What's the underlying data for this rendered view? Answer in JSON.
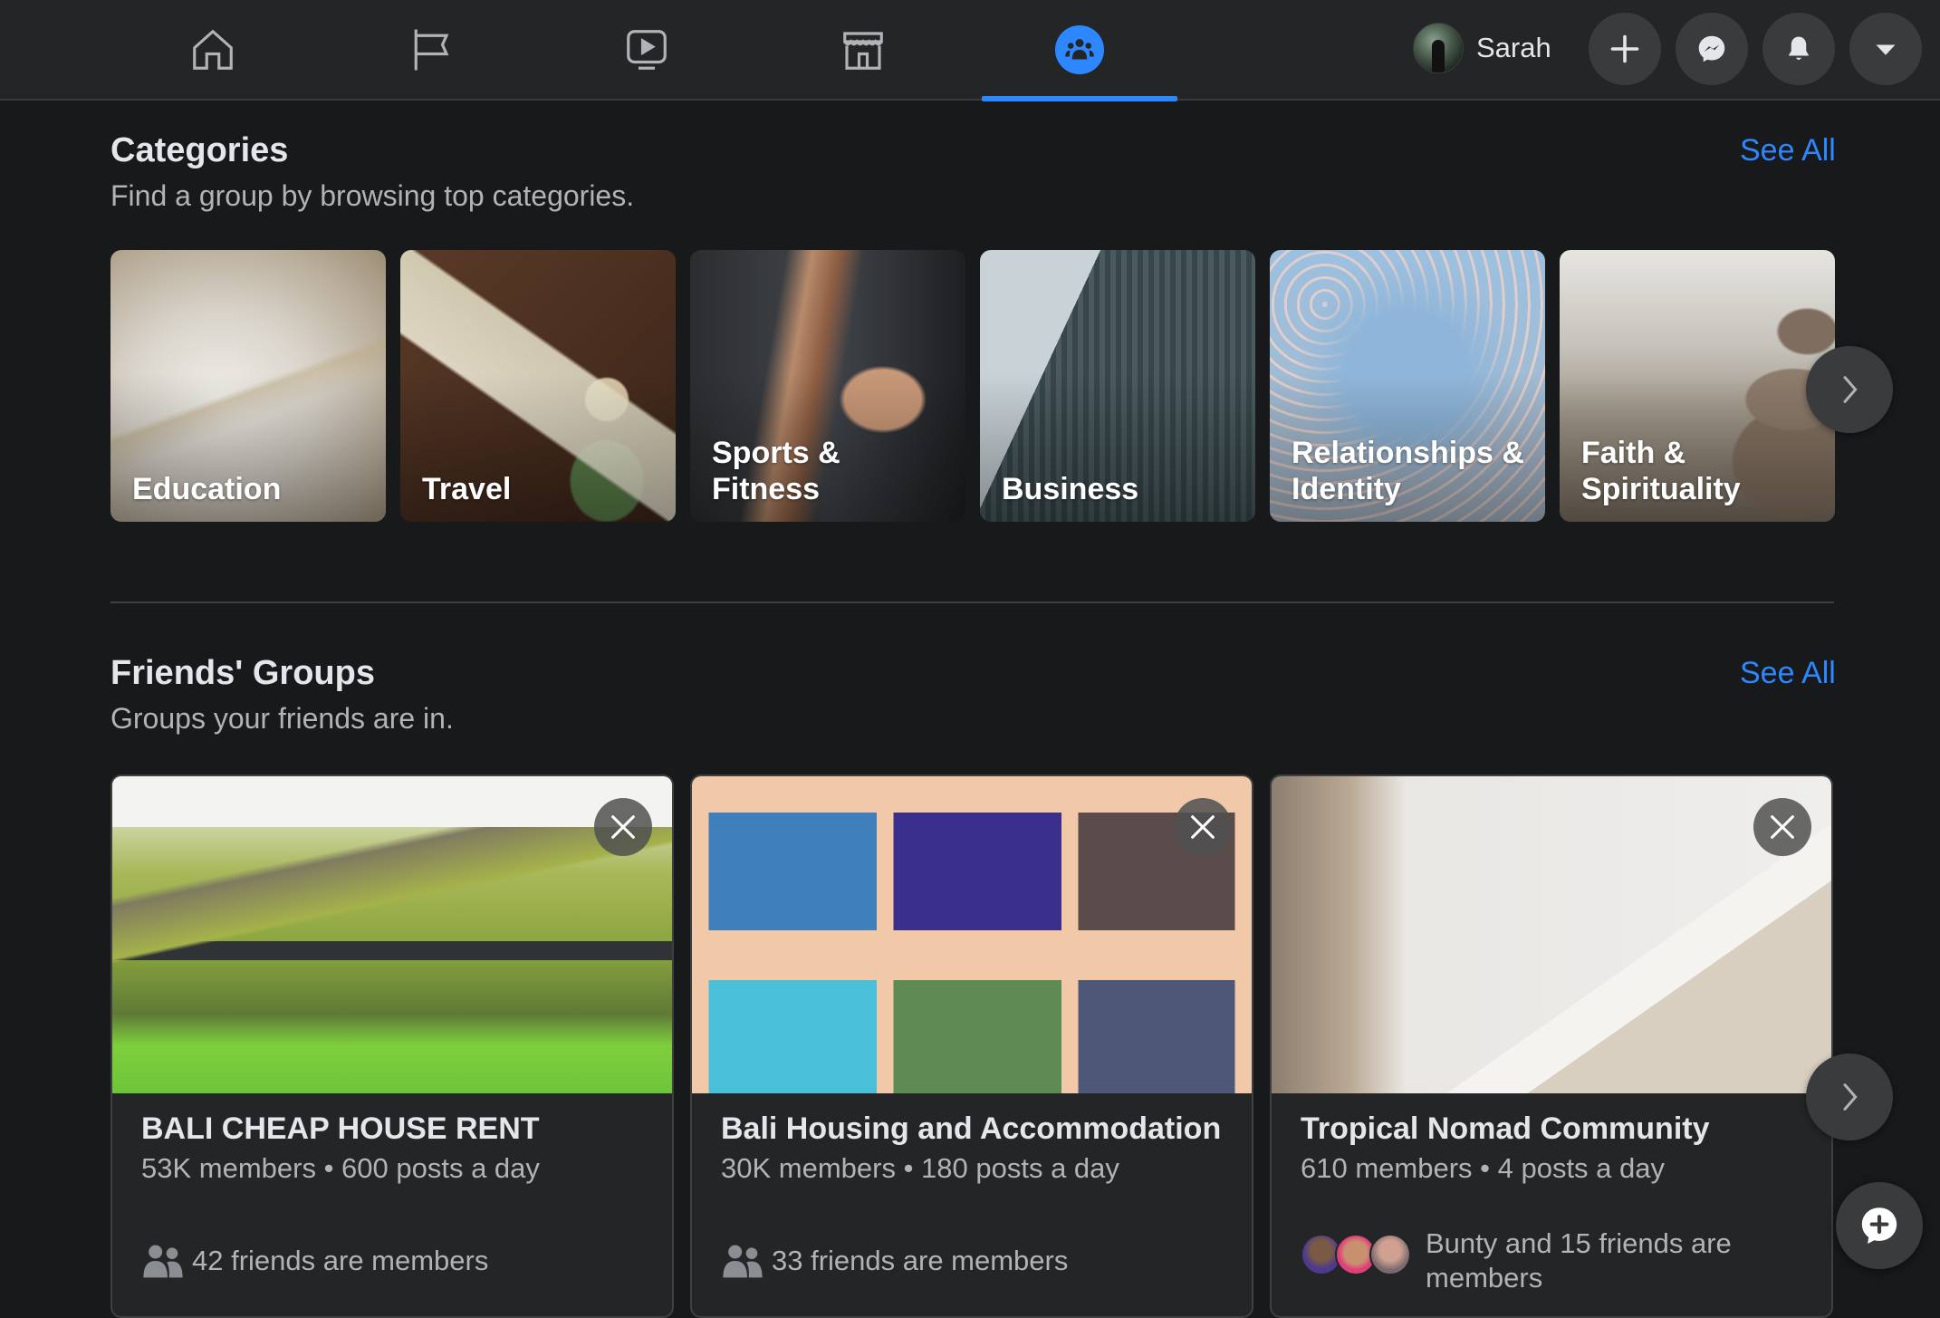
{
  "nav": {
    "tabs": [
      {
        "name": "home",
        "icon": "home-icon",
        "active": false
      },
      {
        "name": "pages",
        "icon": "flag-icon",
        "active": false
      },
      {
        "name": "watch",
        "icon": "video-icon",
        "active": false
      },
      {
        "name": "marketplace",
        "icon": "store-icon",
        "active": false
      },
      {
        "name": "groups",
        "icon": "groups-icon",
        "active": true
      }
    ],
    "profile_name": "Sarah",
    "actions": [
      {
        "name": "create",
        "icon": "plus-icon"
      },
      {
        "name": "messenger",
        "icon": "messenger-icon"
      },
      {
        "name": "notifications",
        "icon": "bell-icon"
      },
      {
        "name": "account",
        "icon": "caret-down-icon"
      }
    ],
    "accent_color": "#2d88ff"
  },
  "categories": {
    "title": "Categories",
    "subtitle": "Find a group by browsing top categories.",
    "see_all": "See All",
    "items": [
      {
        "label": "Education"
      },
      {
        "label": "Travel"
      },
      {
        "label": "Sports & Fitness"
      },
      {
        "label": "Business"
      },
      {
        "label": "Relationships & Identity"
      },
      {
        "label": "Faith & Spirituality"
      }
    ]
  },
  "friends_groups": {
    "title": "Friends' Groups",
    "subtitle": "Groups your friends are in.",
    "see_all": "See All",
    "groups": [
      {
        "name": "BALI CHEAP HOUSE RENT",
        "meta": "53K members • 600 posts a day",
        "friends": "42 friends are members"
      },
      {
        "name": "Bali Housing and Accommodation",
        "meta": "30K members • 180 posts a day",
        "friends": "33 friends are members"
      },
      {
        "name": "Tropical Nomad Community",
        "meta": "610 members • 4 posts a day",
        "friends": "Bunty and 15 friends are members"
      }
    ]
  }
}
